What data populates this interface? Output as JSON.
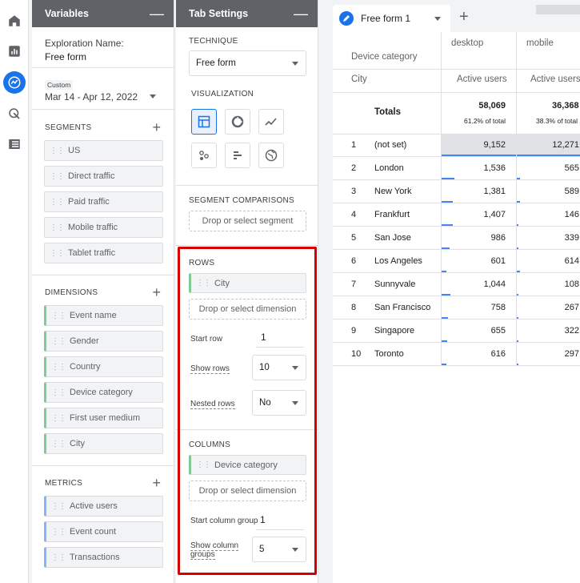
{
  "variables": {
    "title": "Variables",
    "exploration_label": "Exploration Name:",
    "exploration_name": "Free form",
    "date_badge": "Custom",
    "date_range": "Mar 14 - Apr 12, 2022",
    "segments_title": "SEGMENTS",
    "segments": [
      "US",
      "Direct traffic",
      "Paid traffic",
      "Mobile traffic",
      "Tablet traffic"
    ],
    "dimensions_title": "DIMENSIONS",
    "dimensions": [
      "Event name",
      "Gender",
      "Country",
      "Device category",
      "First user medium",
      "City"
    ],
    "metrics_title": "METRICS",
    "metrics": [
      "Active users",
      "Event count",
      "Transactions"
    ]
  },
  "tab_settings": {
    "title": "Tab Settings",
    "technique_title": "TECHNIQUE",
    "technique": "Free form",
    "visualization_title": "VISUALIZATION",
    "segment_comparisons_title": "SEGMENT COMPARISONS",
    "segment_drop": "Drop or select segment",
    "rows_title": "ROWS",
    "rows_chip": "City",
    "rows_drop": "Drop or select dimension",
    "start_row_label": "Start row",
    "start_row": "1",
    "show_rows_label": "Show rows",
    "show_rows": "10",
    "nested_rows_label": "Nested rows",
    "nested_rows": "No",
    "columns_title": "COLUMNS",
    "columns_chip": "Device category",
    "columns_drop": "Drop or select dimension",
    "start_col_label": "Start column group",
    "start_col": "1",
    "show_col_label": "Show column groups",
    "show_col": "5"
  },
  "tab": {
    "name": "Free form 1"
  },
  "table": {
    "dim_header": "Device category",
    "row_header": "City",
    "col1": "desktop",
    "col2": "mobile",
    "metric": "Active users",
    "totals_label": "Totals",
    "total1": "58,069",
    "total1_pct": "61.2% of total",
    "total2": "36,368",
    "total2_pct": "38.3% of total",
    "rows": [
      {
        "n": "1",
        "city": "(not set)",
        "d": "9,152",
        "m": "12,271"
      },
      {
        "n": "2",
        "city": "London",
        "d": "1,536",
        "m": "565"
      },
      {
        "n": "3",
        "city": "New York",
        "d": "1,381",
        "m": "589"
      },
      {
        "n": "4",
        "city": "Frankfurt",
        "d": "1,407",
        "m": "146"
      },
      {
        "n": "5",
        "city": "San Jose",
        "d": "986",
        "m": "339"
      },
      {
        "n": "6",
        "city": "Los Angeles",
        "d": "601",
        "m": "614"
      },
      {
        "n": "7",
        "city": "Sunnyvale",
        "d": "1,044",
        "m": "108"
      },
      {
        "n": "8",
        "city": "San Francisco",
        "d": "758",
        "m": "267"
      },
      {
        "n": "9",
        "city": "Singapore",
        "d": "655",
        "m": "322"
      },
      {
        "n": "10",
        "city": "Toronto",
        "d": "616",
        "m": "297"
      }
    ]
  },
  "colors": {
    "accent": "#1a73e8",
    "highlight": "#d50000"
  }
}
